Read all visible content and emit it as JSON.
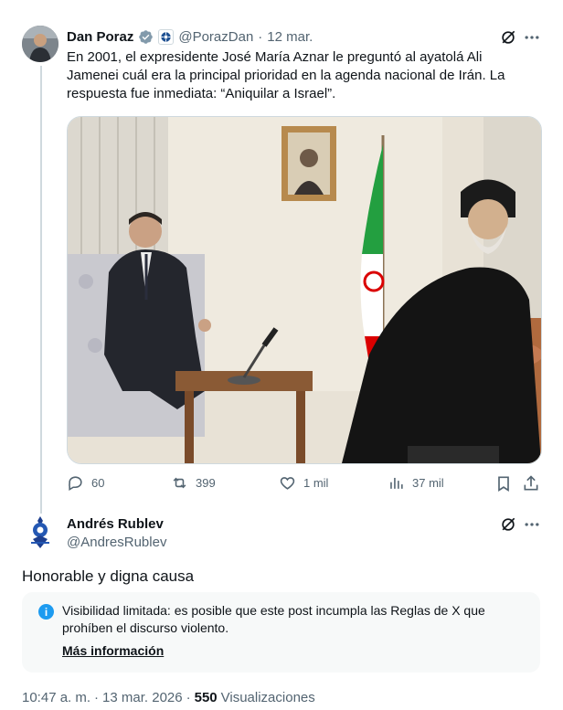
{
  "tweet": {
    "author_name": "Dan Poraz",
    "handle": "@PorazDan",
    "separator": "·",
    "date": "12 mar.",
    "text": "En 2001, el expresidente José María Aznar le preguntó al ayatolá Ali Jamenei cuál era la principal prioridad en la agenda nacional de Irán. La respuesta fue inmediata: “Aniquilar a Israel”.",
    "stats": {
      "replies": "60",
      "reposts": "399",
      "likes": "1 mil",
      "views": "37 mil"
    }
  },
  "reply": {
    "author_name": "Andrés Rublev",
    "handle": "@AndresRublev",
    "text": "Honorable y digna causa",
    "notice": {
      "text": "Visibilidad limitada: es posible que este post incumpla las Reglas de X que prohíben el discurso violento.",
      "link": "Más información"
    },
    "meta": {
      "time": "10:47 a. m.",
      "sep1": "·",
      "date": "13 mar. 2026",
      "sep2": "·",
      "views_count": "550",
      "views_label": "Visualizaciones"
    }
  },
  "colors": {
    "accent": "#1d9bf0",
    "muted": "#536471",
    "verified": "#829aab"
  },
  "icons": [
    "verified-badge-icon",
    "affiliate-badge-icon",
    "grok-icon",
    "more-icon",
    "reply-icon",
    "repost-icon",
    "like-icon",
    "views-icon",
    "bookmark-icon",
    "share-icon",
    "info-icon"
  ]
}
